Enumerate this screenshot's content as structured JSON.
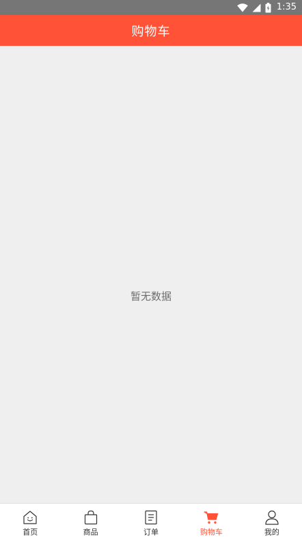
{
  "status_bar": {
    "time": "1:35",
    "icons": [
      "wifi-icon",
      "cell-signal-icon",
      "battery-icon"
    ]
  },
  "header": {
    "title": "购物车"
  },
  "main": {
    "empty_message": "暂无数据"
  },
  "tab_bar": {
    "active_index": 3,
    "tabs": [
      {
        "label": "首页",
        "icon": "home-icon"
      },
      {
        "label": "商品",
        "icon": "bag-icon"
      },
      {
        "label": "订单",
        "icon": "order-list-icon"
      },
      {
        "label": "购物车",
        "icon": "cart-icon"
      },
      {
        "label": "我的",
        "icon": "user-icon"
      }
    ]
  },
  "colors": {
    "accent": "#ff5236",
    "status_bar": "#767676",
    "background": "#efefef"
  }
}
